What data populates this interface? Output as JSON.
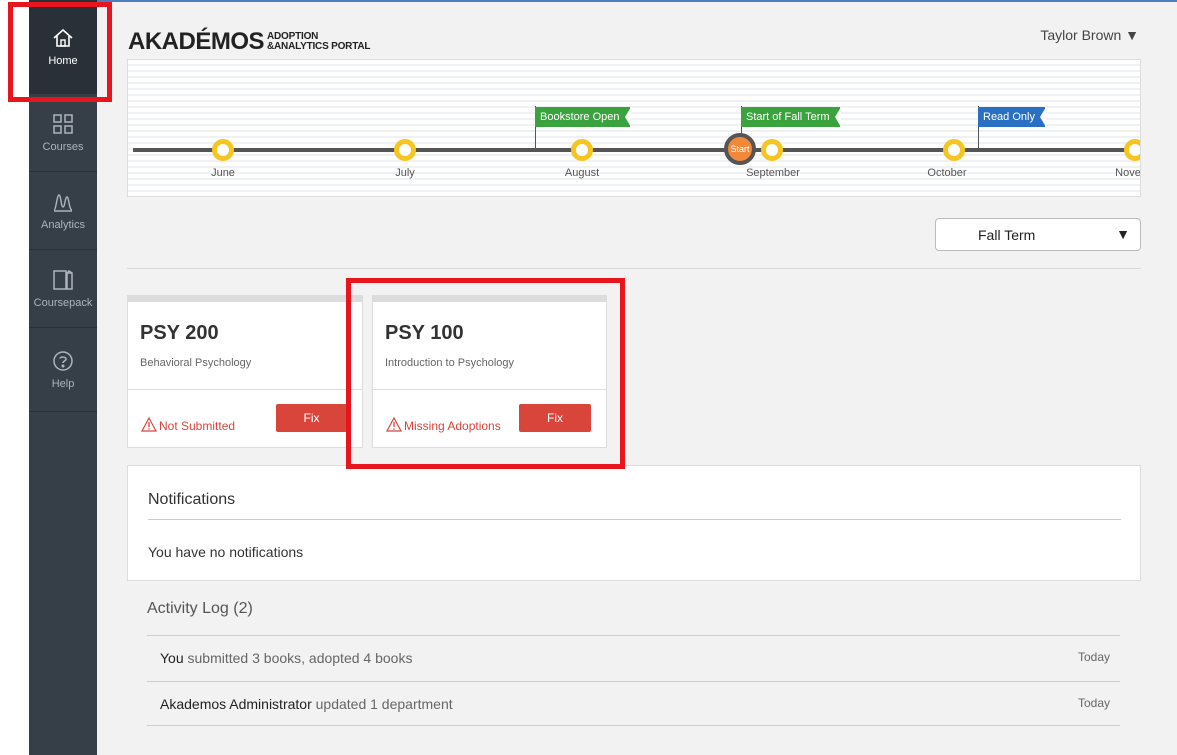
{
  "sidebar": {
    "items": [
      {
        "label": "Home",
        "icon": "home-icon"
      },
      {
        "label": "Courses",
        "icon": "grid-icon"
      },
      {
        "label": "Analytics",
        "icon": "analytics-icon"
      },
      {
        "label": "Coursepack",
        "icon": "book-icon"
      },
      {
        "label": "Help",
        "icon": "help-icon"
      }
    ]
  },
  "header": {
    "logo_main": "AKADÉMOS",
    "logo_sub_top": "ADOPTION",
    "logo_sub_bottom": "&ANALYTICS PORTAL",
    "user_name": "Taylor Brown ▼"
  },
  "timeline": {
    "months": [
      "June",
      "July",
      "August",
      "September",
      "October",
      "Nove"
    ],
    "flags": [
      {
        "label": "Bookstore Open",
        "color": "#3aa33e"
      },
      {
        "label": "Start of Fall Term",
        "color": "#3aa33e"
      },
      {
        "label": "Read Only",
        "color": "#2a70c2"
      }
    ],
    "start_label": "Start"
  },
  "term_select": {
    "value": "Fall Term",
    "caret": "▼"
  },
  "courses": [
    {
      "code": "PSY 200",
      "name": "Behavioral Psychology",
      "status": "Not Submitted",
      "action": "Fix"
    },
    {
      "code": "PSY 100",
      "name": "Introduction to Psychology",
      "status": "Missing Adoptions",
      "action": "Fix"
    }
  ],
  "notifications": {
    "title": "Notifications",
    "empty_text": "You have no notifications"
  },
  "activity": {
    "title": "Activity Log (2)",
    "rows": [
      {
        "who": "You",
        "what": "submitted 3 books, adopted 4 books",
        "when": "Today"
      },
      {
        "who": "Akademos Administrator",
        "what": "updated 1 department",
        "when": "Today"
      }
    ]
  },
  "colors": {
    "accent_red": "#d9443b",
    "sidebar_bg": "#363e47",
    "flag_green": "#3aa33e",
    "flag_blue": "#2a70c2",
    "highlight": "#e8161c"
  }
}
